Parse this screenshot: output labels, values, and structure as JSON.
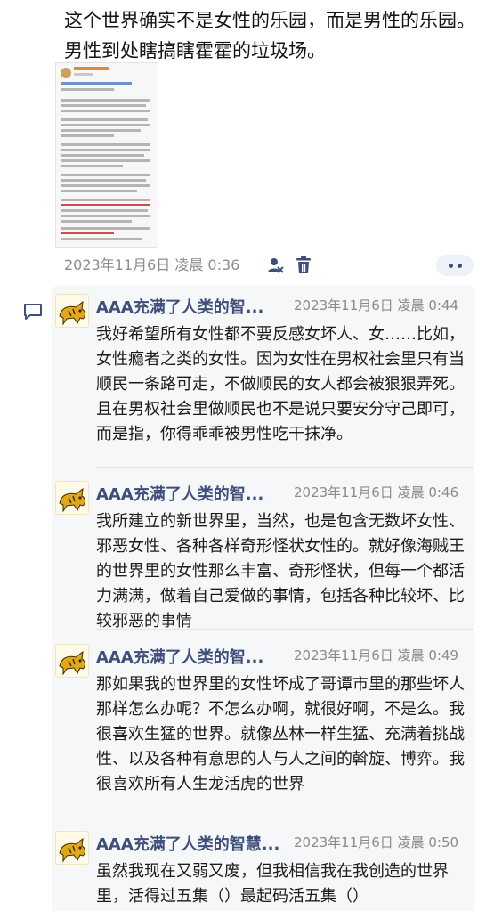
{
  "post": {
    "text": "这个世界确实不是女性的乐园，而是男性的乐园。男性到处瞎搞瞎霍霍的垃圾场。",
    "date": "2023年11月6日 凌晨 0:36"
  },
  "icons": {
    "user": "user-settings-icon",
    "trash": "trash-icon",
    "more": "more-dots-icon",
    "comment": "comment-icon",
    "avatar": "tiger-avatar-icon"
  },
  "colors": {
    "name": "#3e4f7c",
    "meta": "#8d8d8d",
    "thread_bg": "#f6f7f9"
  },
  "replies": [
    {
      "name": "AAA充满了人类的智...",
      "time": "2023年11月6日 凌晨 0:44",
      "text": "我好希望所有女性都不要反感女坏人、女……比如，女性瘾者之类的女性。因为女性在男权社会里只有当顺民一条路可走，不做顺民的女人都会被狠狠弄死。且在男权社会里做顺民也不是说只要安分守己即可，而是指，你得乖乖被男性吃干抹净。"
    },
    {
      "name": "AAA充满了人类的智...",
      "time": "2023年11月6日 凌晨 0:46",
      "text": "我所建立的新世界里，当然，也是包含无数坏女性、邪恶女性、各种各样奇形怪状女性的。就好像海贼王的世界里的女性那么丰富、奇形怪状，但每一个都活力满满，做着自己爱做的事情，包括各种比较坏、比较邪恶的事情"
    },
    {
      "name": "AAA充满了人类的智...",
      "time": "2023年11月6日 凌晨 0:49",
      "text": "那如果我的世界里的女性坏成了哥谭市里的那些坏人那样怎么办呢？不怎么办啊，就很好啊，不是么。我很喜欢生猛的世界。就像丛林一样生猛、充满着挑战性、以及各种有意思的人与人之间的斡旋、博弈。我很喜欢所有人生龙活虎的世界"
    },
    {
      "name": "AAA充满了人类的智慧...",
      "time": "2023年11月6日 凌晨 0:50",
      "text": "虽然我现在又弱又废，但我相信我在我创造的世界里，活得过五集（）最起码活五集（）"
    }
  ]
}
